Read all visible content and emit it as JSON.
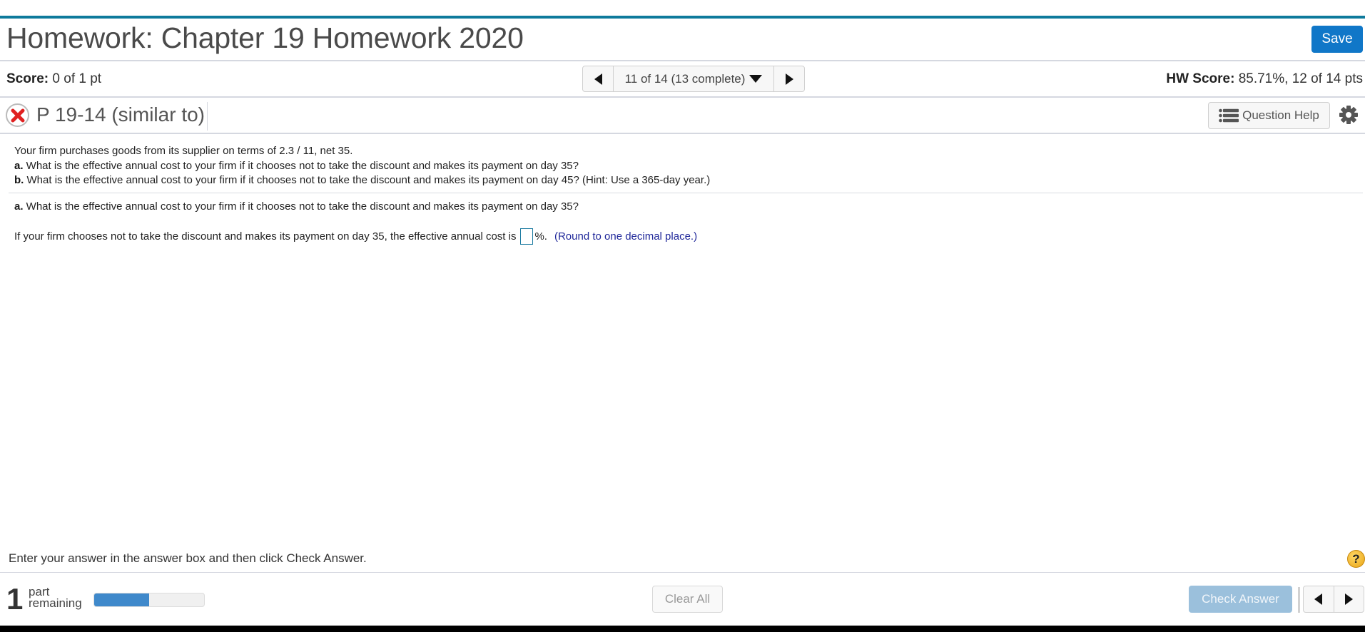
{
  "header": {
    "title": "Homework: Chapter 19 Homework 2020",
    "save_label": "Save"
  },
  "score_bar": {
    "score_label": "Score:",
    "score_value": " 0 of 1 pt",
    "nav_position": "11 of 14 (13 complete)",
    "hw_score_label": "HW Score:",
    "hw_score_value": " 85.71%, 12 of 14 pts"
  },
  "question_bar": {
    "status_icon": "incorrect-x-icon",
    "question_id": "P 19-14 (similar to)",
    "help_label": "Question Help",
    "settings_icon": "gear-icon"
  },
  "prompt": {
    "intro": "Your firm purchases goods from its supplier on terms of 2.3 / 11, net 35.",
    "part_a_letter": "a.",
    "part_a_text": " What is the effective annual cost to your firm if it chooses not to take the discount and makes its payment on day 35?",
    "part_b_letter": "b.",
    "part_b_text": " What is the effective annual cost to your firm if it chooses not to take the discount and makes its payment on day 45? (Hint: Use a 365-day year.)"
  },
  "current_part": {
    "letter": "a.",
    "question": " What is the effective annual cost to your firm if it chooses not to take the discount and makes its payment on day 35?",
    "answer_prefix": "If your firm chooses not to take the discount and makes its payment on day 35, the effective annual cost is",
    "answer_value": "",
    "answer_suffix": "%.",
    "hint": "(Round to one decimal place.)"
  },
  "footer": {
    "instruction": "Enter your answer in the answer box and then click Check Answer.",
    "parts_remaining_count": "1",
    "parts_remaining_line1": "part",
    "parts_remaining_line2": "remaining",
    "progress_fraction": 0.5,
    "clear_label": "Clear All",
    "check_label": "Check Answer",
    "help_icon": "?"
  },
  "colors": {
    "accent_bar": "#0e7a9c",
    "save_button": "#1077c8",
    "check_button_disabled": "#9bc0dc",
    "progress_fill": "#3f89cb",
    "hint_text": "#20289a",
    "incorrect_red": "#e02020"
  }
}
